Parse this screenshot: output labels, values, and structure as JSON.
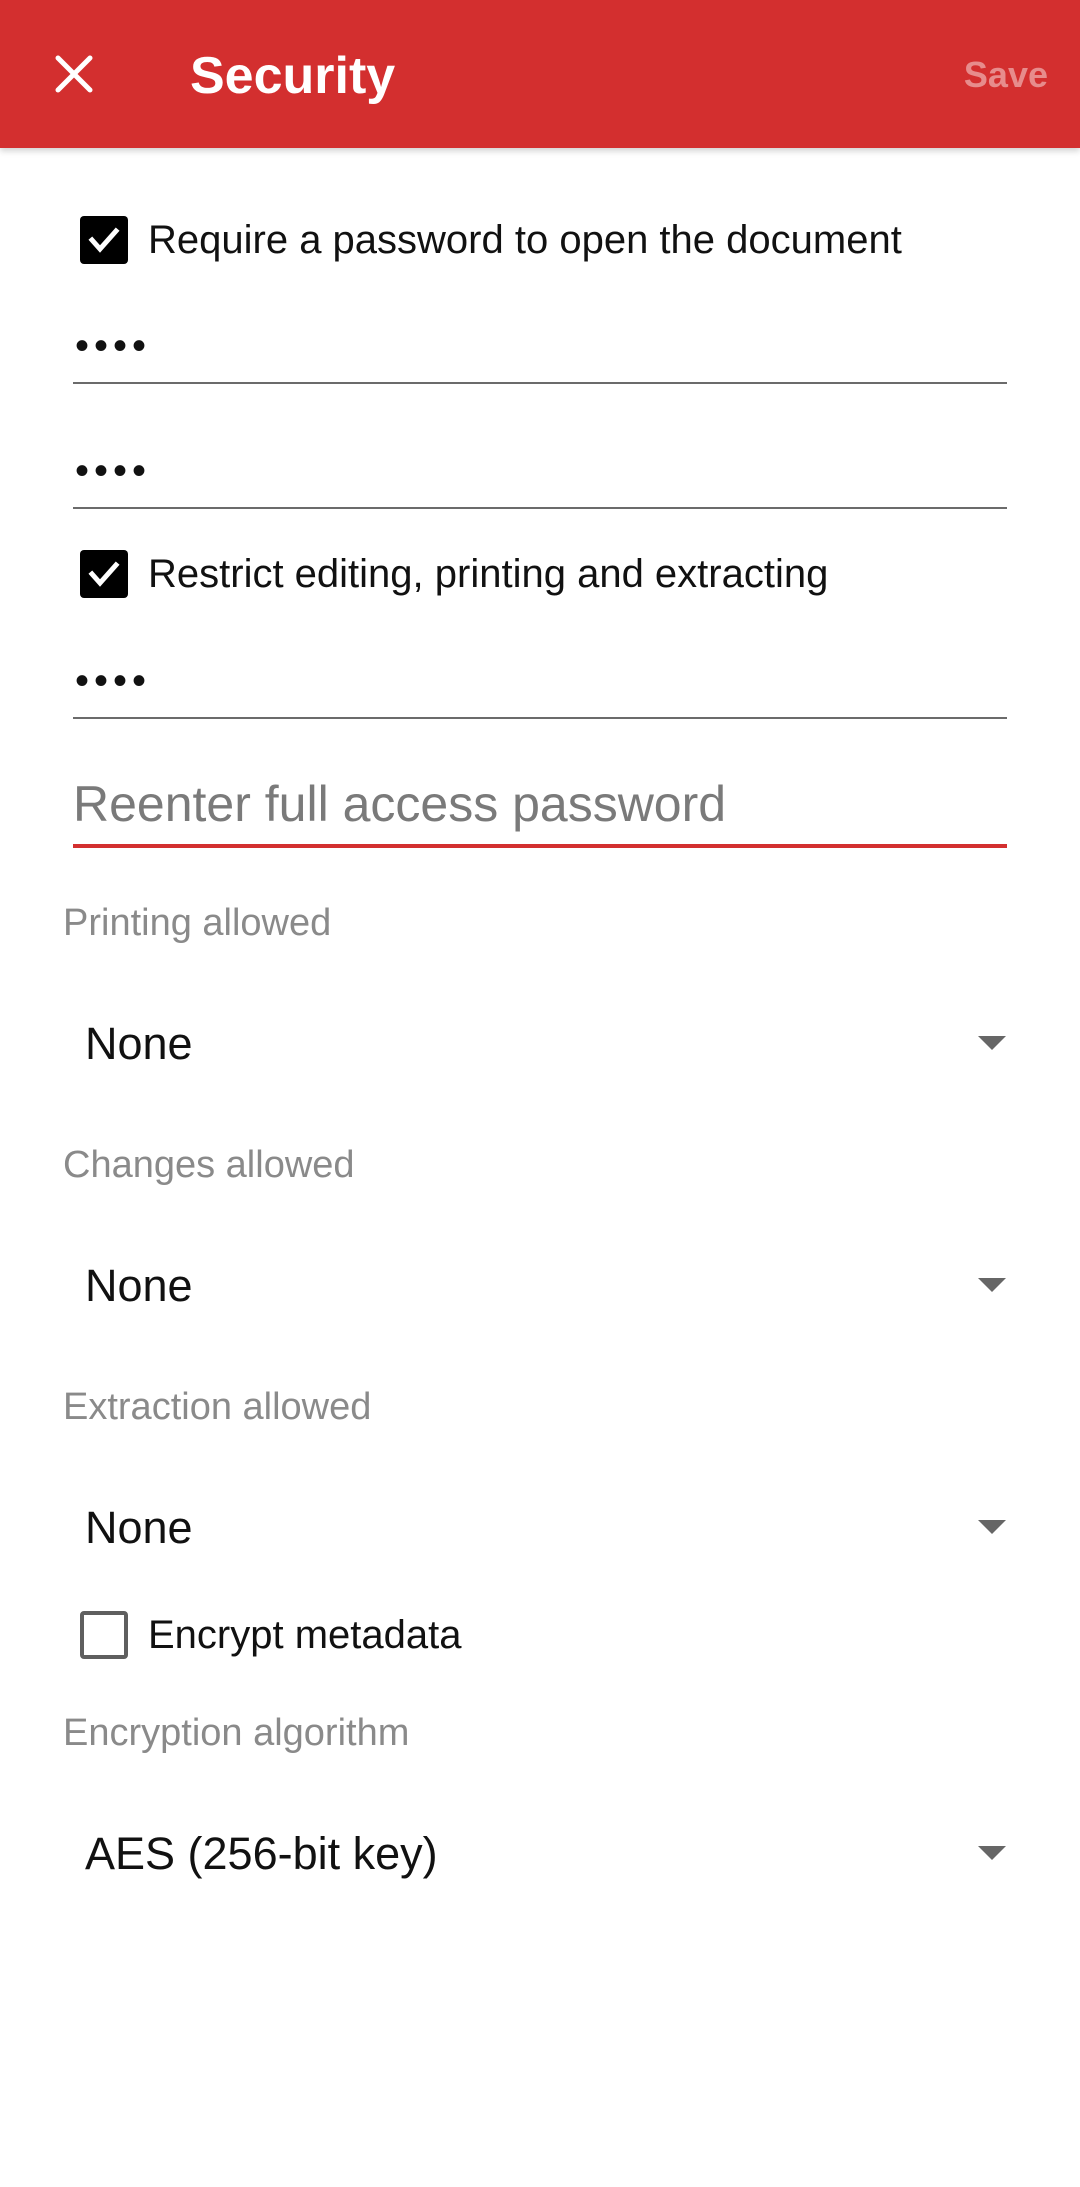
{
  "appbar": {
    "title": "Security",
    "save_label": "Save",
    "close_icon": "close-icon",
    "background": "#d32f2f"
  },
  "open_password": {
    "checkbox_label": "Require a password to open the document",
    "checked": true,
    "password_value": "••••",
    "confirm_value": "••••"
  },
  "restrict": {
    "checkbox_label": "Restrict editing, printing and extracting",
    "checked": true,
    "password_value": "••••",
    "reenter_placeholder": "Reenter full access password"
  },
  "printing": {
    "label": "Printing allowed",
    "value": "None"
  },
  "changes": {
    "label": "Changes allowed",
    "value": "None"
  },
  "extraction": {
    "label": "Extraction allowed",
    "value": "None"
  },
  "encrypt_metadata": {
    "label": "Encrypt metadata",
    "checked": false
  },
  "algorithm": {
    "label": "Encryption algorithm",
    "value": "AES (256-bit key)"
  },
  "colors": {
    "accent": "#d32f2f",
    "checkbox_checked": "#000000",
    "hint_text": "#8a8a8a"
  }
}
